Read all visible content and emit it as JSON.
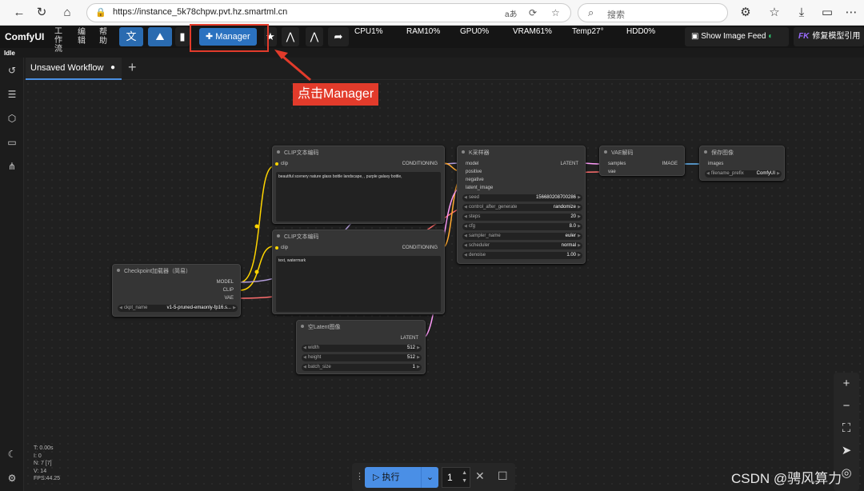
{
  "browser": {
    "url": "https://instance_5k78chpw.pvt.hz.smartml.cn",
    "search_placeholder": "搜索",
    "read_aloud": "aあ"
  },
  "menu": {
    "logo": "ComfyUI",
    "workflow": "工作流",
    "edit": "编辑",
    "help": "帮助",
    "manager": "Manager",
    "stats": {
      "cpu": "CPU1%",
      "ram": "RAM10%",
      "gpu": "GPU0%",
      "vram": "VRAM61%",
      "temp": "Temp27°",
      "hdd": "HDD0%"
    },
    "image_feed": "Show Image Feed",
    "fix_prefix": "FK",
    "fix_label": "修复模型引用"
  },
  "status": "Idle",
  "tabs": {
    "active": "Unsaved Workflow",
    "dot": "●",
    "add": "+"
  },
  "annotation": {
    "label": "点击Manager"
  },
  "nodes": {
    "clip1": {
      "title": "CLIP文本编码",
      "in": "clip",
      "out": "CONDITIONING",
      "text": "beautiful scenery nature glass bottle landscape, , purple galaxy bottle,"
    },
    "clip2": {
      "title": "CLIP文本编码",
      "in": "clip",
      "out": "CONDITIONING",
      "text": "text, watermark"
    },
    "checkpoint": {
      "title": "Checkpoint加载器（简易）",
      "out_model": "MODEL",
      "out_clip": "CLIP",
      "out_vae": "VAE",
      "w_label": "ckpt_name",
      "w_value": "v1-5-pruned-emaonly-fp16.s..."
    },
    "latent": {
      "title": "空Latent图像",
      "out": "LATENT",
      "width_label": "width",
      "width": "512",
      "height_label": "height",
      "height": "512",
      "batch_label": "batch_size",
      "batch": "1"
    },
    "ksampler": {
      "title": "K采样器",
      "in_model": "model",
      "in_positive": "positive",
      "in_negative": "negative",
      "in_latent": "latent_image",
      "out": "LATENT",
      "seed_label": "seed",
      "seed": "156680208700286",
      "control_label": "control_after_generate",
      "control": "randomize",
      "steps_label": "steps",
      "steps": "20",
      "cfg_label": "cfg",
      "cfg": "8.0",
      "sampler_label": "sampler_name",
      "sampler": "euler",
      "scheduler_label": "scheduler",
      "scheduler": "normal",
      "denoise_label": "denoise",
      "denoise": "1.00"
    },
    "vae": {
      "title": "VAE解码",
      "in_samples": "samples",
      "in_vae": "vae",
      "out": "IMAGE"
    },
    "save": {
      "title": "保存图像",
      "in": "images",
      "w_label": "filename_prefix",
      "w_value": "ComfyUI"
    }
  },
  "stats_overlay": {
    "t": "T: 0.00s",
    "i": "I: 0",
    "n": "N: 7 [7]",
    "v": "V: 14",
    "fps": "FPS:44.25"
  },
  "queue": {
    "run": "执行",
    "count": "1"
  },
  "watermark": "CSDN @骋风算力"
}
